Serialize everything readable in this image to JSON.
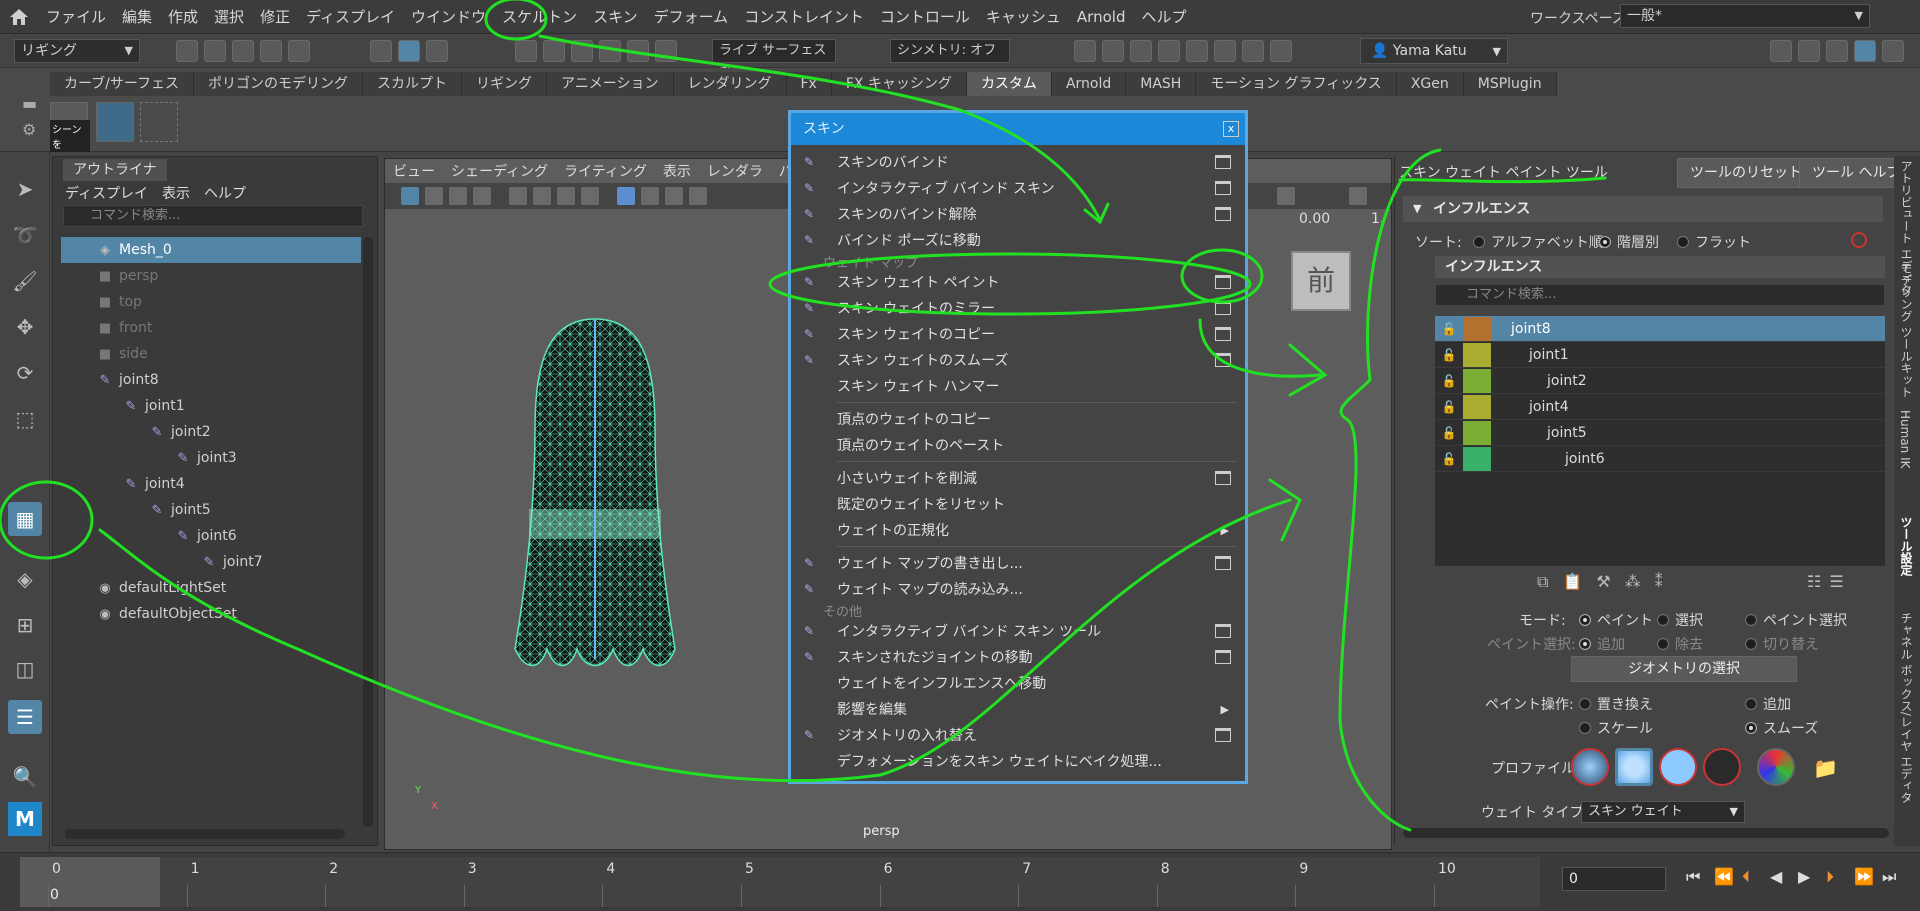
{
  "menubar": {
    "items": [
      "ファイル",
      "編集",
      "作成",
      "選択",
      "修正",
      "ディスプレイ",
      "ウインドウ",
      "スケルトン",
      "スキン",
      "デフォーム",
      "コンストレイント",
      "コントロール",
      "キャッシュ",
      "Arnold",
      "ヘルプ"
    ],
    "workspace_label": "ワークスペース:",
    "workspace_value": "一般*"
  },
  "statusline": {
    "mode": "リギング",
    "live_surface": "ライブ サーフェスなし",
    "symmetry": "シンメトリ: オフ",
    "user": "Yama Katu"
  },
  "shelf": {
    "tabs": [
      "カーブ/サーフェス",
      "ポリゴンのモデリング",
      "スカルプト",
      "リギング",
      "アニメーション",
      "レンダリング",
      "Fx",
      "FX キャッシング",
      "カスタム",
      "Arnold",
      "MASH",
      "モーション グラフィックス",
      "XGen",
      "MSPlugin"
    ],
    "active_tab": "カスタム",
    "button_label": "シーンを"
  },
  "outliner": {
    "tab": "アウトライナ",
    "menu": [
      "ディスプレイ",
      "表示",
      "ヘルプ"
    ],
    "search_placeholder": "コマンド検索...",
    "items": [
      {
        "label": "Mesh_0",
        "indent": 0,
        "icon": "mesh-icon"
      },
      {
        "label": "persp",
        "indent": 0,
        "icon": "camera-icon"
      },
      {
        "label": "top",
        "indent": 0,
        "icon": "camera-icon"
      },
      {
        "label": "front",
        "indent": 0,
        "icon": "camera-icon"
      },
      {
        "label": "side",
        "indent": 0,
        "icon": "camera-icon"
      },
      {
        "label": "joint8",
        "indent": 0,
        "icon": "joint-icon"
      },
      {
        "label": "joint1",
        "indent": 1,
        "icon": "joint-icon"
      },
      {
        "label": "joint2",
        "indent": 2,
        "icon": "joint-icon"
      },
      {
        "label": "joint3",
        "indent": 3,
        "icon": "joint-icon"
      },
      {
        "label": "joint4",
        "indent": 1,
        "icon": "joint-icon"
      },
      {
        "label": "joint5",
        "indent": 2,
        "icon": "joint-icon"
      },
      {
        "label": "joint6",
        "indent": 3,
        "icon": "joint-icon"
      },
      {
        "label": "joint7",
        "indent": 4,
        "icon": "joint-icon"
      },
      {
        "label": "defaultLightSet",
        "indent": 0,
        "icon": "set-icon"
      },
      {
        "label": "defaultObjectSet",
        "indent": 0,
        "icon": "set-icon"
      }
    ]
  },
  "viewport": {
    "menu": [
      "ビュー",
      "シェーディング",
      "ライティング",
      "表示",
      "レンダラ",
      "パネル"
    ],
    "camera_label": "persp",
    "value_a": "0.00",
    "value_b": "1.",
    "view_cube": "前",
    "axis_y": "Y",
    "axis_x": "X"
  },
  "skin_menu": {
    "title": "スキン",
    "close": "x",
    "group1": [
      "スキンのバインド",
      "インタラクティブ バインド スキン",
      "スキンのバインド解除",
      "バインド ポーズに移動"
    ],
    "section_weightmap": "ウェイト マップ",
    "group2": [
      "スキン ウェイト ペイント",
      "スキン ウェイトのミラー",
      "スキン ウェイトのコピー",
      "スキン ウェイトのスムーズ",
      "スキン ウェイト ハンマー"
    ],
    "group3": [
      "頂点のウェイトのコピー",
      "頂点のウェイトのペースト"
    ],
    "group4": [
      "小さいウェイトを削減",
      "既定のウェイトをリセット",
      "ウェイトの正規化"
    ],
    "group5": [
      "ウェイト マップの書き出し...",
      "ウェイト マップの読み込み..."
    ],
    "section_other": "その他",
    "group6": [
      "インタラクティブ バインド スキン ツール",
      "スキンされたジョイントの移動",
      "ウェイトをインフルエンスへ移動",
      "影響を編集",
      "ジオメトリの入れ替え",
      "デフォメーションをスキン ウェイトにベイク処理..."
    ]
  },
  "tool_settings": {
    "title": "スキン ウェイト ペイント ツール",
    "reset": "ツールのリセット",
    "help": "ツール ヘルプ",
    "frame_influence": "インフルエンス",
    "sort_label": "ソート:",
    "sort_options": [
      "アルファベット順",
      "階層別",
      "フラット"
    ],
    "sub_frame": "インフルエンス",
    "search_placeholder": "コマンド検索...",
    "influences": [
      {
        "label": "joint8",
        "indent": 0,
        "color": "#b4702e"
      },
      {
        "label": "joint1",
        "indent": 1,
        "color": "#a8ad32"
      },
      {
        "label": "joint2",
        "indent": 2,
        "color": "#7cae36"
      },
      {
        "label": "joint4",
        "indent": 1,
        "color": "#a8ad32"
      },
      {
        "label": "joint5",
        "indent": 2,
        "color": "#7cae36"
      },
      {
        "label": "joint6",
        "indent": 3,
        "color": "#39b06a"
      }
    ],
    "mode_label": "モード:",
    "mode_options": [
      "ペイント",
      "選択",
      "ペイント選択"
    ],
    "paint_select_label": "ペイント選択:",
    "paint_select_options": [
      "追加",
      "除去",
      "切り替え"
    ],
    "geometry_button": "ジオメトリの選択",
    "paint_op_label": "ペイント操作:",
    "paint_ops": [
      "置き換え",
      "追加",
      "スケール",
      "スムーズ"
    ],
    "profile_label": "プロファイル:",
    "weight_type_label": "ウェイト タイプ:",
    "weight_type_value": "スキン ウェイト"
  },
  "vtabs": [
    "アトリビュート エディタ",
    "モデリング ツールキット",
    "Human IK",
    "ツール設定",
    "チャネル ボックス/レイヤ エディタ"
  ],
  "timeline": {
    "ticks": [
      "0",
      "1",
      "2",
      "3",
      "4",
      "5",
      "6",
      "7",
      "8",
      "9",
      "10"
    ],
    "current": "0",
    "frame_field": "0"
  },
  "colors": {
    "accent": "#5285a6",
    "menu_title": "#1e88d8",
    "annotation": "#22e022",
    "wireframe": "#5de8b8"
  }
}
